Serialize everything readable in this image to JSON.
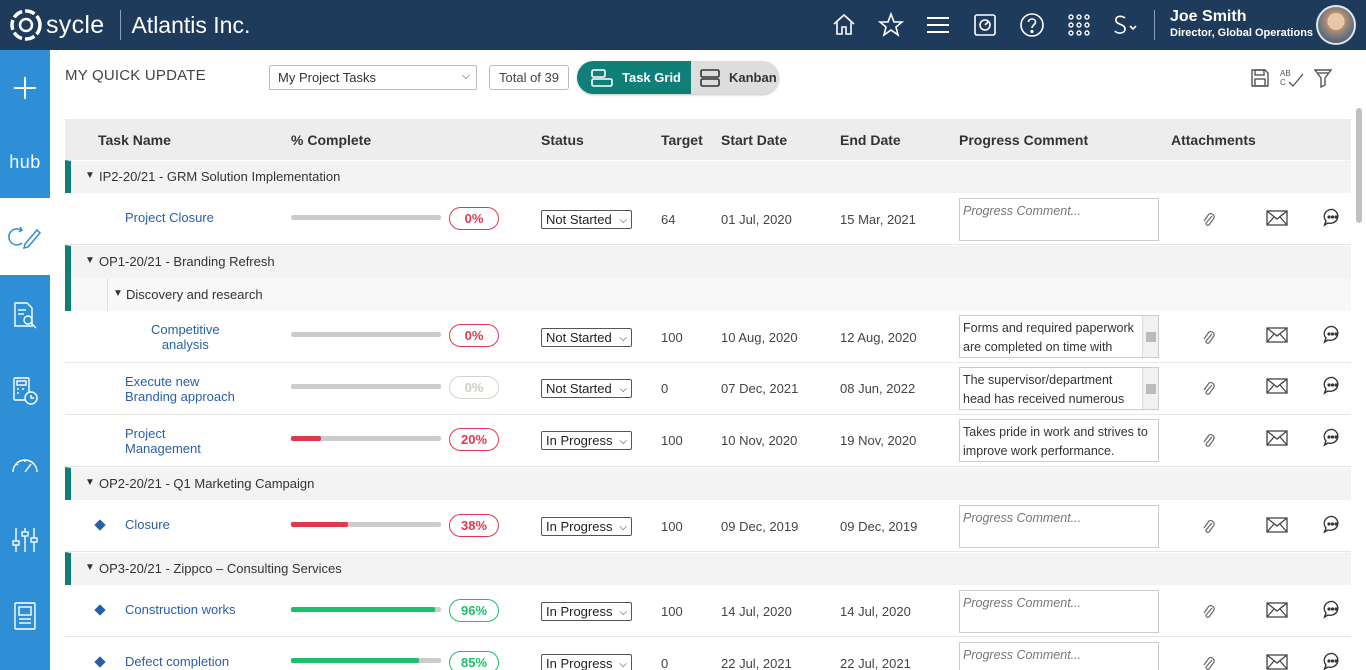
{
  "header": {
    "logo_text": "sycle",
    "company": "Atlantis Inc.",
    "user_name": "Joe Smith",
    "user_role": "Director, Global Operations",
    "icons": [
      "home-icon",
      "star-icon",
      "menu-icon",
      "dashboard-icon",
      "help-icon",
      "apps-grid-icon",
      "s-switch-icon"
    ]
  },
  "sidebar": {
    "hub_label": "hub",
    "items": [
      "plus-icon",
      "hub-label",
      "quick-update-icon",
      "search-doc-icon",
      "calculator-clock-icon",
      "gauge-icon",
      "filter-sliders-icon",
      "report-icon"
    ]
  },
  "toolbar": {
    "title": "MY QUICK UPDATE",
    "view_select": "My Project Tasks",
    "total": "Total of 39",
    "task_grid_label": "Task Grid",
    "kanban_label": "Kanban"
  },
  "columns": {
    "task_name": "Task Name",
    "pct_complete": "% Complete",
    "status": "Status",
    "target": "Target",
    "start_date": "Start Date",
    "end_date": "End Date",
    "progress_comment": "Progress Comment",
    "attachments": "Attachments"
  },
  "comment_placeholder": "Progress Comment...",
  "groups": {
    "g1": "IP2-20/21 - GRM Solution Implementation",
    "g2": "OP1-20/21 - Branding Refresh",
    "g2_sub": "Discovery and research",
    "g3": "OP2-20/21 - Q1 Marketing Campaign",
    "g4": "OP3-20/21 - Zippco – Consulting Services"
  },
  "tasks": {
    "t1": {
      "name": "Project Closure",
      "pct": "0%",
      "status": "Not Started",
      "target": "64",
      "start": "01 Jul, 2020",
      "end": "15 Mar, 2021",
      "comment": "",
      "progress": 0
    },
    "t2": {
      "name_l1": "Competitive",
      "name_l2": "analysis",
      "pct": "0%",
      "status": "Not Started",
      "target": "100",
      "start": "10 Aug, 2020",
      "end": "12 Aug, 2020",
      "comment": "Forms and required paperwork are completed on time with",
      "progress": 0
    },
    "t3": {
      "name_l1": "Execute new",
      "name_l2": "Branding approach",
      "pct": "0%",
      "status": "Not Started",
      "target": "0",
      "start": "07 Dec, 2021",
      "end": "08 Jun, 2022",
      "comment": "The supervisor/department head has received numerous",
      "progress": 0
    },
    "t4": {
      "name_l1": "Project",
      "name_l2": "Management",
      "pct": "20%",
      "status": "In Progress",
      "target": "100",
      "start": "10 Nov, 2020",
      "end": "19 Nov, 2020",
      "comment": "Takes pride in work and strives to improve work performance.",
      "progress": 20
    },
    "t5": {
      "name": "Closure",
      "pct": "38%",
      "status": "In Progress",
      "target": "100",
      "start": "09 Dec, 2019",
      "end": "09 Dec, 2019",
      "comment": "",
      "progress": 38
    },
    "t6": {
      "name": "Construction works",
      "pct": "96%",
      "status": "In Progress",
      "target": "100",
      "start": "14 Jul, 2020",
      "end": "14 Jul, 2020",
      "comment": "",
      "progress": 96
    },
    "t7": {
      "name": "Defect completion",
      "pct": "85%",
      "status": "In Progress",
      "target": "0",
      "start": "22 Jul, 2021",
      "end": "22 Jul, 2021",
      "comment": "",
      "progress": 85
    }
  },
  "colors": {
    "topbar": "#1f3b5c",
    "sidebar": "#2e8fd6",
    "teal": "#0f7f78",
    "red": "#e0394f",
    "green": "#1cbf6b",
    "link": "#2a5ea8"
  }
}
